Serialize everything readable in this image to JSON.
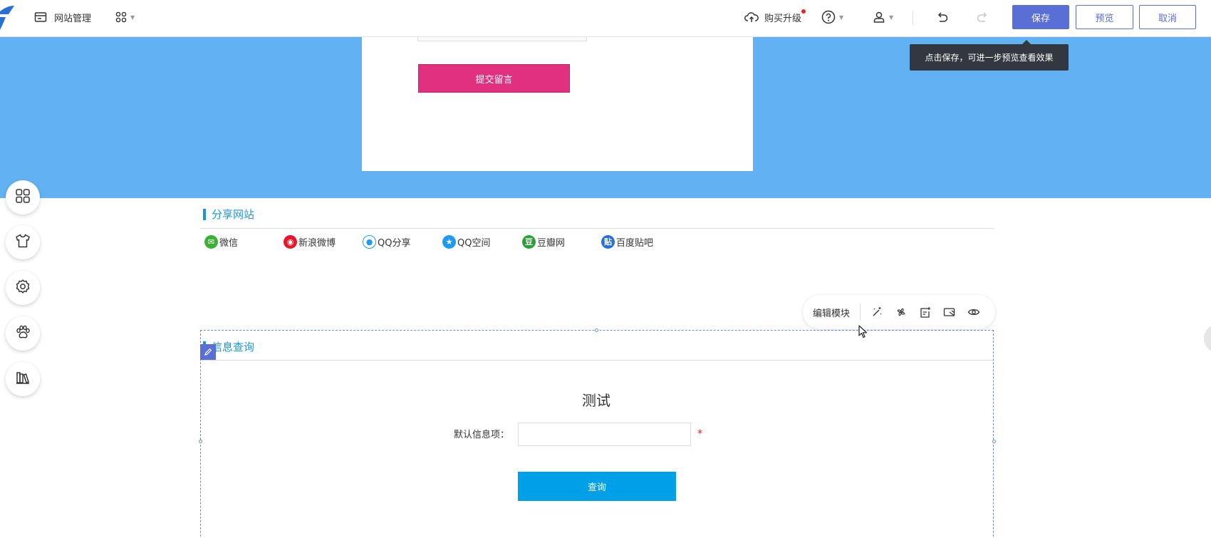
{
  "topbar": {
    "site_manage": "网站管理",
    "upgrade": "购买升级",
    "save": "保存",
    "preview": "预览",
    "cancel": "取消"
  },
  "tooltip": "点击保存，可进一步预览查看效果",
  "message_form": {
    "submit": "提交留言"
  },
  "share_module": {
    "title": "分享网站",
    "items": [
      {
        "label": "微信",
        "icon": "wechat-icon",
        "color": "#3cb034"
      },
      {
        "label": "新浪微博",
        "icon": "weibo-icon",
        "color": "#e6162d"
      },
      {
        "label": "QQ分享",
        "icon": "qq-icon",
        "color": "#1e9bf0"
      },
      {
        "label": "QQ空间",
        "icon": "qzone-icon",
        "color": "#1e9bf0"
      },
      {
        "label": "豆瓣网",
        "icon": "douban-icon",
        "color": "#2d9e3a"
      },
      {
        "label": "百度贴吧",
        "icon": "tieba-icon",
        "color": "#2a6fd6"
      }
    ]
  },
  "module_toolbar": {
    "edit": "编辑模块"
  },
  "query_module": {
    "title": "信息查询",
    "form_title": "测试",
    "field_label": "默认信息项：",
    "field_value": "",
    "required_mark": "*",
    "query_button": "查询"
  },
  "colors": {
    "accent": "#5a6fd6",
    "banner": "#62b1f2",
    "pink": "#e0307f",
    "query_button": "#00a0e9",
    "module_title": "#1a96d8"
  }
}
